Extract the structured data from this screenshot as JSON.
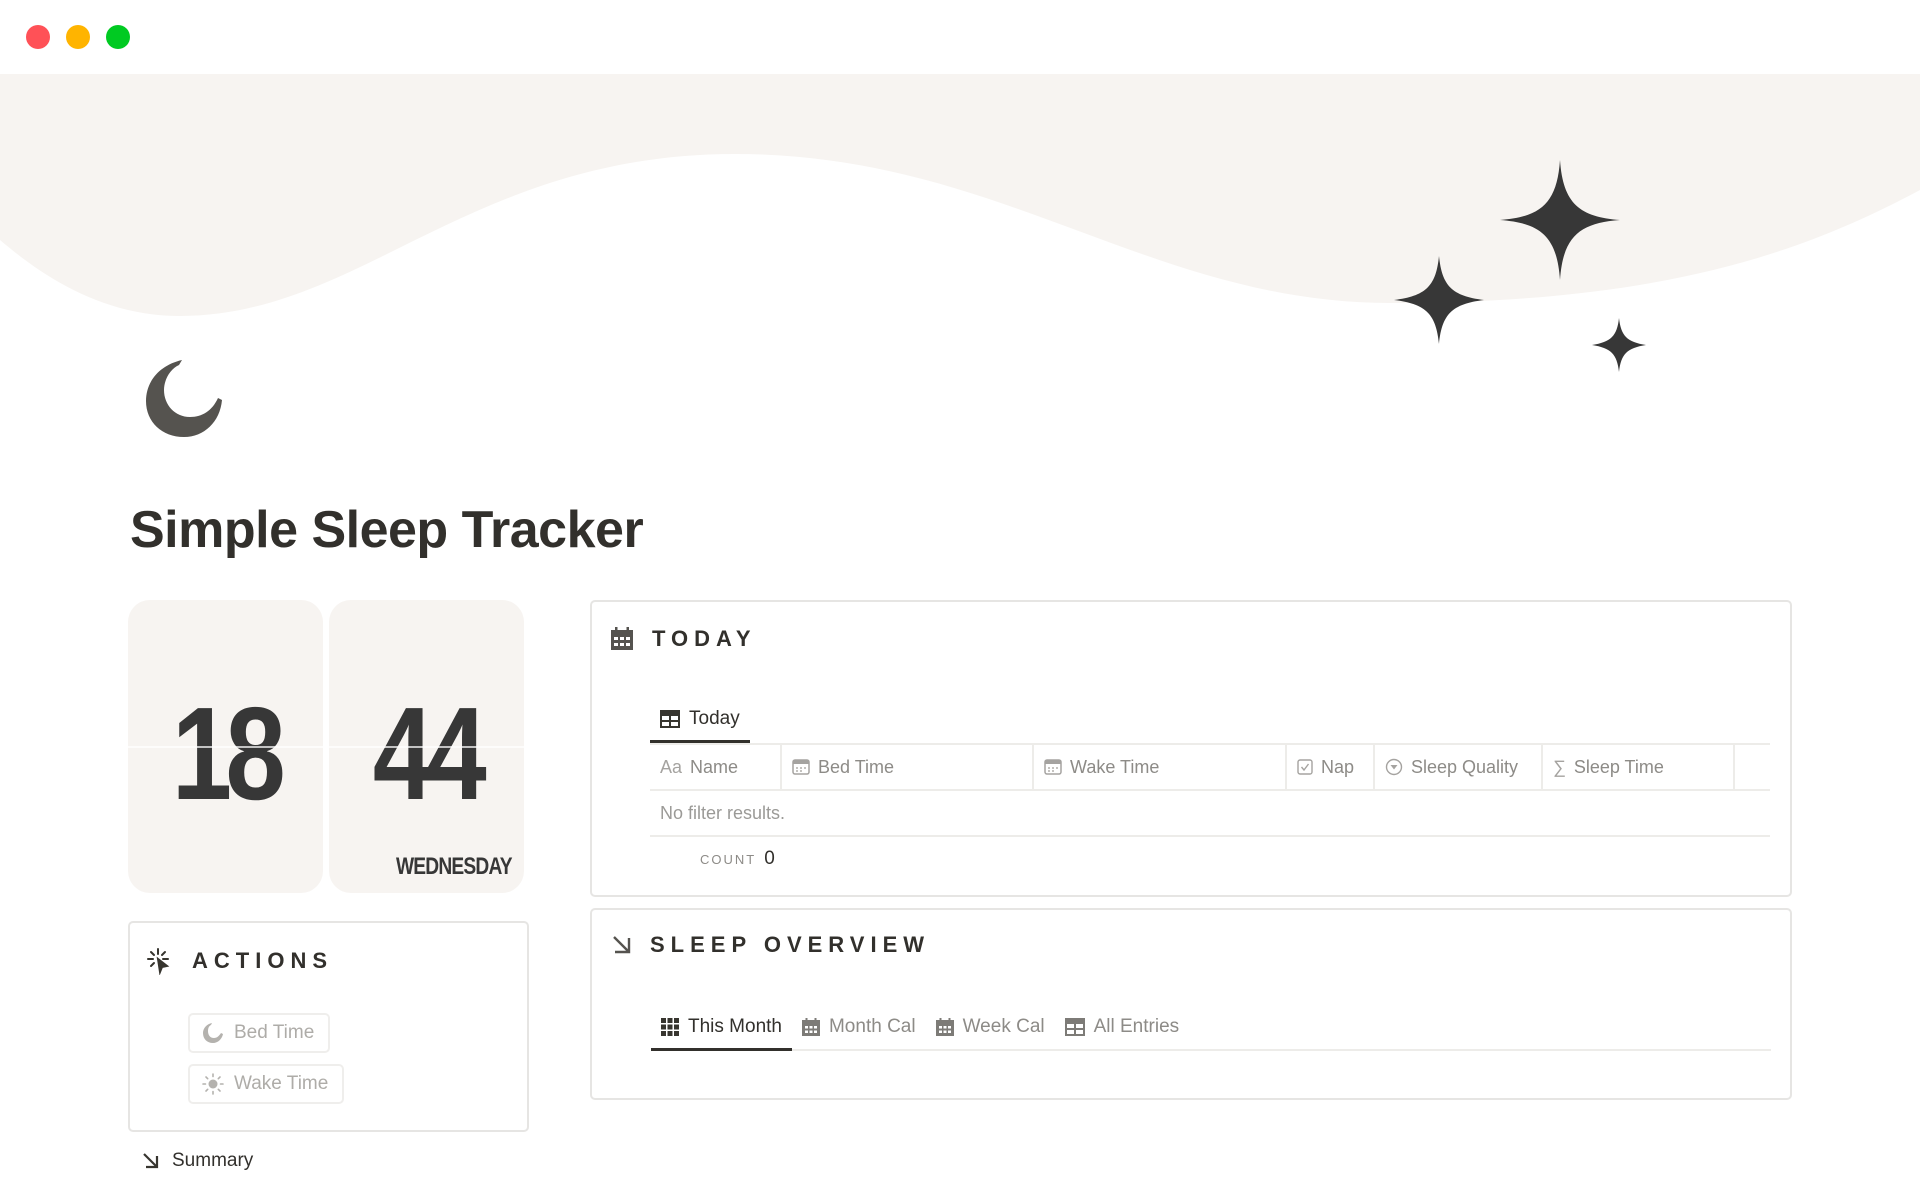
{
  "window": {
    "controls": [
      "close",
      "minimize",
      "maximize"
    ]
  },
  "colors": {
    "cover": "#f7f4f1",
    "ink": "#32302c",
    "muted": "#8d8b87",
    "border": "#e6e5e3",
    "traffic_red": "#ff5157",
    "traffic_yellow": "#ffb400",
    "traffic_green": "#00ca22"
  },
  "page": {
    "icon": "crescent-moon-icon",
    "title": "Simple Sleep Tracker"
  },
  "clock": {
    "hours": "18",
    "minutes": "44",
    "day": "WEDNESDAY"
  },
  "actions": {
    "title": "ACTIONS",
    "icon": "cursor-click-icon",
    "buttons": [
      {
        "label": "Bed Time",
        "icon": "moon-icon"
      },
      {
        "label": "Wake Time",
        "icon": "sun-icon"
      }
    ]
  },
  "summary": {
    "label": "Summary",
    "icon": "arrow-down-right-icon"
  },
  "today": {
    "title": "TODAY",
    "icon": "calendar-icon",
    "tabs": [
      {
        "label": "Today",
        "icon": "table-icon",
        "active": true
      }
    ],
    "columns": [
      {
        "label": "Name",
        "icon": "text-icon",
        "icon_text": "Aa"
      },
      {
        "label": "Bed Time",
        "icon": "date-icon"
      },
      {
        "label": "Wake Time",
        "icon": "date-icon"
      },
      {
        "label": "Nap",
        "icon": "checkbox-icon"
      },
      {
        "label": "Sleep Quality",
        "icon": "select-icon"
      },
      {
        "label": "Sleep Time",
        "icon": "formula-icon",
        "icon_text": "∑"
      }
    ],
    "empty_message": "No filter results.",
    "count_label": "COUNT",
    "count_value": "0"
  },
  "overview": {
    "title": "SLEEP OVERVIEW",
    "icon": "arrow-down-right-icon",
    "tabs": [
      {
        "label": "This Month",
        "icon": "gallery-icon",
        "active": true
      },
      {
        "label": "Month Cal",
        "icon": "calendar-icon",
        "active": false
      },
      {
        "label": "Week Cal",
        "icon": "calendar-icon",
        "active": false
      },
      {
        "label": "All Entries",
        "icon": "table-icon",
        "active": false
      }
    ]
  }
}
